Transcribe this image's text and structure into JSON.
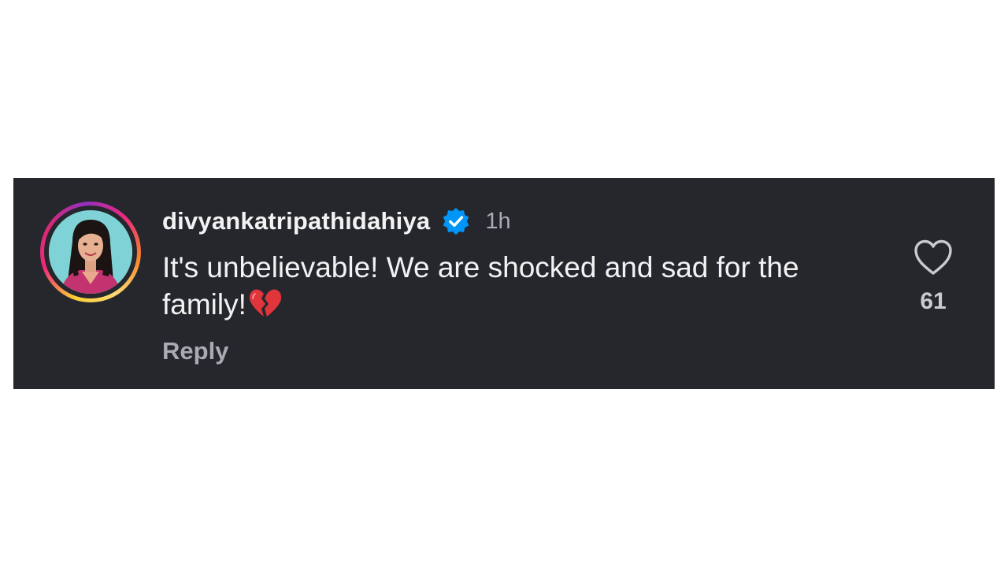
{
  "comment": {
    "username": "divyankatripathidahiya",
    "verified_icon": "verified-badge-icon",
    "timestamp": "1h",
    "text": "It's unbelievable! We are shocked and sad for the family!",
    "emoji": "broken-heart-emoji",
    "reply_label": "Reply",
    "like_count": "61",
    "like_icon": "heart-outline-icon"
  },
  "colors": {
    "card_background": "#25272d",
    "verified_blue": "#0095f6",
    "text_primary": "#f2f2f2",
    "text_secondary": "#a8abb2",
    "broken_heart_red": "#e0353b"
  }
}
